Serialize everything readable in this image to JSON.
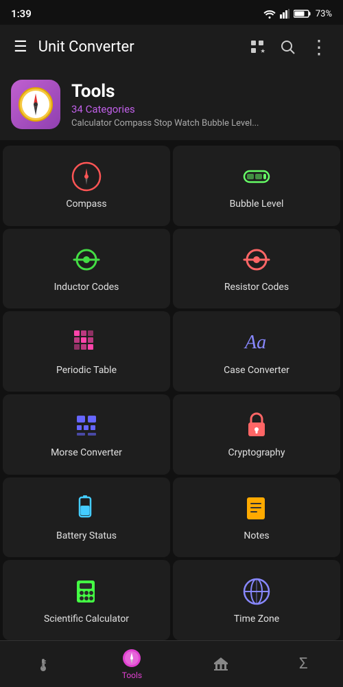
{
  "statusBar": {
    "time": "1:39",
    "battery": "73%"
  },
  "appBar": {
    "title": "Unit Converter"
  },
  "header": {
    "title": "Tools",
    "subtitle": "34 Categories",
    "description": "Calculator Compass Stop Watch Bubble Level..."
  },
  "grid": [
    {
      "id": "compass",
      "label": "Compass",
      "iconColor": "#f55",
      "iconType": "compass"
    },
    {
      "id": "bubble-level",
      "label": "Bubble Level",
      "iconColor": "#6f6",
      "iconType": "bubble"
    },
    {
      "id": "inductor-codes",
      "label": "Inductor Codes",
      "iconColor": "#4d4",
      "iconType": "inductor"
    },
    {
      "id": "resistor-codes",
      "label": "Resistor Codes",
      "iconColor": "#f66",
      "iconType": "resistor"
    },
    {
      "id": "periodic-table",
      "label": "Periodic Table",
      "iconColor": "#f4a",
      "iconType": "periodic"
    },
    {
      "id": "case-converter",
      "label": "Case Converter",
      "iconColor": "#88f",
      "iconType": "case"
    },
    {
      "id": "morse-converter",
      "label": "Morse Converter",
      "iconColor": "#66f",
      "iconType": "morse"
    },
    {
      "id": "cryptography",
      "label": "Cryptography",
      "iconColor": "#f66",
      "iconType": "crypto"
    },
    {
      "id": "battery-status",
      "label": "Battery Status",
      "iconColor": "#4cf",
      "iconType": "battery"
    },
    {
      "id": "notes",
      "label": "Notes",
      "iconColor": "#fa0",
      "iconType": "notes"
    },
    {
      "id": "scientific-calculator",
      "label": "Scientific Calculator",
      "iconColor": "#4f4",
      "iconType": "calculator"
    },
    {
      "id": "time-zone",
      "label": "Time Zone",
      "iconColor": "#88f",
      "iconType": "globe"
    }
  ],
  "bottomNav": [
    {
      "id": "temperature",
      "label": "",
      "icon": "thermometer",
      "active": false
    },
    {
      "id": "tools",
      "label": "Tools",
      "icon": "compass",
      "active": true
    },
    {
      "id": "converters",
      "label": "",
      "icon": "bank",
      "active": false
    },
    {
      "id": "sum",
      "label": "",
      "icon": "sigma",
      "active": false
    }
  ]
}
